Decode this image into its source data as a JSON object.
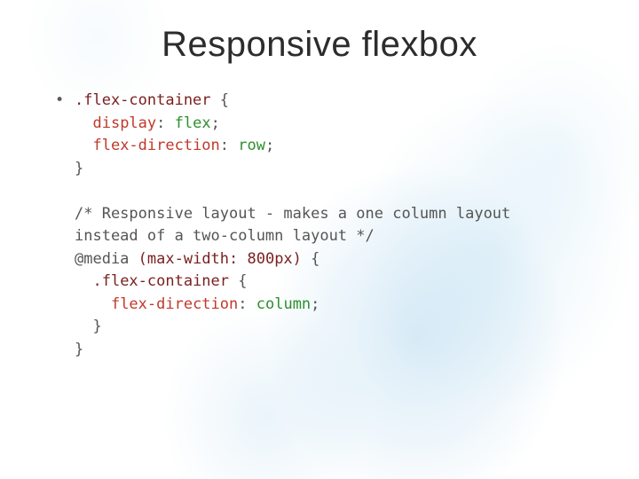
{
  "title": "Responsive flexbox",
  "code": {
    "sel1": ".flex-container",
    "brace_open": " {",
    "prop_display": "display",
    "val_flex": "flex",
    "prop_flexdir": "flex-direction",
    "val_row": "row",
    "brace_close": "}",
    "comment_l1": "/* Responsive layout - makes a one column layout",
    "comment_l2": "instead of a two-column layout */",
    "at_media": "@media",
    "media_cond": "(max-width: 800px)",
    "sel2": ".flex-container",
    "val_column": "column",
    "colon": ":",
    "semicolon": ";"
  }
}
